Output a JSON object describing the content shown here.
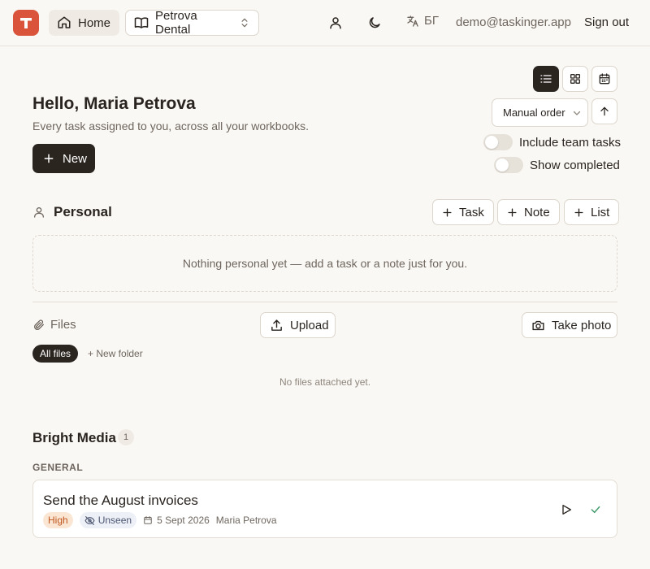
{
  "header": {
    "logo_letter": "T",
    "home_label": "Home",
    "workspace_label": "Petrova Dental",
    "language_label": "БГ",
    "email": "demo@taskinger.app",
    "signout_label": "Sign out"
  },
  "greeting": {
    "title": "Hello, Maria Petrova",
    "subtitle": "Every task assigned to you, across all your workbooks.",
    "new_label": "New"
  },
  "controls": {
    "order_label": "Manual order",
    "include_team_label": "Include team tasks",
    "include_team_on": false,
    "show_completed_label": "Show completed",
    "show_completed_on": false,
    "active_view": "list"
  },
  "personal": {
    "title": "Personal",
    "buttons": [
      "Task",
      "Note",
      "List"
    ],
    "empty_text": "Nothing personal yet — add a task or a note just for you."
  },
  "files": {
    "title": "Files",
    "upload_label": "Upload",
    "photo_label": "Take photo",
    "all_files_label": "All files",
    "new_folder_label": "+ New folder",
    "empty_text": "No files attached yet."
  },
  "workbook": {
    "title": "Bright Media",
    "count": "1",
    "group": "GENERAL",
    "tasks": [
      {
        "title": "Send the August invoices",
        "priority": "High",
        "status": "Unseen",
        "date": "5 Sept 2026",
        "assignee": "Maria Petrova"
      }
    ]
  },
  "colors": {
    "brand": "#d9543a",
    "dark_button": "#2b2520",
    "background": "#faf8f4",
    "priority_high_bg": "#fbe6d4",
    "priority_high_text": "#c0561e",
    "done_check": "#3f9a6b"
  }
}
